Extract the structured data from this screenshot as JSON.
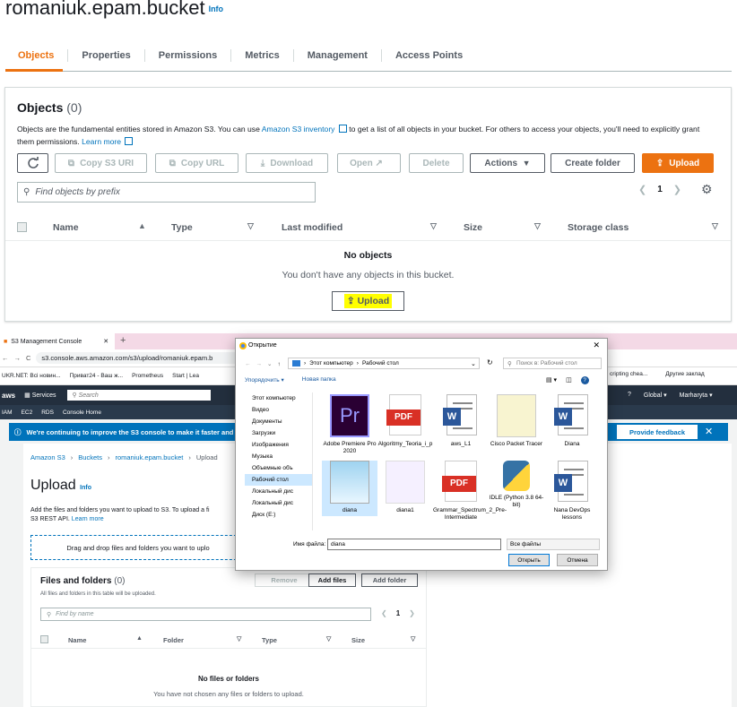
{
  "bucket": {
    "name": "romaniuk.epam.bucket",
    "info": "Info"
  },
  "tabs": [
    "Objects",
    "Properties",
    "Permissions",
    "Metrics",
    "Management",
    "Access Points"
  ],
  "objects": {
    "heading": "Objects",
    "count": "(0)",
    "desc_1": "Objects are the fundamental entities stored in Amazon S3. You can use ",
    "desc_link": "Amazon S3 inventory",
    "desc_2": " to get a list of all objects in your bucket. For others to access your objects, you'll need to explicitly grant them permissions. ",
    "learn_more": "Learn more",
    "buttons": {
      "copy_uri": "Copy S3 URI",
      "copy_url": "Copy URL",
      "download": "Download",
      "open": "Open",
      "delete": "Delete",
      "actions": "Actions",
      "create_folder": "Create folder",
      "upload": "Upload"
    },
    "search_placeholder": "Find objects by prefix",
    "page": "1",
    "columns": [
      "Name",
      "Type",
      "Last modified",
      "Size",
      "Storage class"
    ],
    "empty_title": "No objects",
    "empty_text": "You don't have any objects in this bucket.",
    "empty_upload": "Upload"
  },
  "browser": {
    "tab_title": "S3 Management Console",
    "url": "s3.console.aws.amazon.com/s3/upload/romaniuk.epam.b",
    "bookmarks": [
      "UKR.NET: Всі новин...",
      "Приват24 - Ваш ж...",
      "Prometheus",
      "Start | Lea"
    ],
    "bookmarks_right": [
      "cripting chea...",
      "Другие заклад"
    ],
    "aws_services": "Services",
    "aws_search": "Search",
    "aws_region": "Global",
    "aws_user": "Marharyta",
    "aws_shortcuts": [
      "IAM",
      "EC2",
      "RDS",
      "Console Home"
    ]
  },
  "upload_page": {
    "banner": "We're continuing to improve the S3 console to make it faster and e",
    "feedback": "Provide feedback",
    "crumbs": [
      "Amazon S3",
      "Buckets",
      "romaniuk.epam.bucket",
      "Upload"
    ],
    "title": "Upload",
    "info": "Info",
    "desc": "Add the files and folders you want to upload to S3. To upload a fi",
    "desc2": "S3 REST API.",
    "learn_more": "Learn more",
    "dropzone": "Drag and drop files and folders you want to uplo",
    "ff_title": "Files and folders",
    "ff_count": "(0)",
    "ff_sub": "All files and folders in this table will be uploaded.",
    "remove": "Remove",
    "add_files": "Add files",
    "add_folder": "Add folder",
    "find_placeholder": "Find by name",
    "page": "1",
    "cols": [
      "Name",
      "Folder",
      "Type",
      "Size"
    ],
    "empty_title": "No files or folders",
    "empty_text": "You have not chosen any files or folders to upload."
  },
  "dialog": {
    "title": "Открытие",
    "path_1": "Этот компьютер",
    "path_2": "Рабочий стол",
    "search": "Поиск в: Рабочий стол",
    "organize": "Упорядочить",
    "new_folder": "Новая папка",
    "tree": [
      "Этот компьютер",
      "Видео",
      "Документы",
      "Загрузки",
      "Изображения",
      "Музыка",
      "Объемные объ",
      "Рабочий стол",
      "Локальный дис",
      "Локальный дис",
      "Диск (E:)"
    ],
    "files": [
      "Adobe Premiere Pro 2020",
      "Algoritmy_Teoria_i_p",
      "aws_L1",
      "Cisco Packet Tracer",
      "Diana",
      "diana",
      "diana1",
      "Grammar_Spectrum_2_Pre-Intermediate",
      "IDLE (Python 3.8 64-bit)",
      "Nana DevOps lessons"
    ],
    "filename_label": "Имя файла:",
    "filename": "diana",
    "filetype": "Все файлы",
    "open": "Открыть",
    "cancel": "Отмена"
  }
}
